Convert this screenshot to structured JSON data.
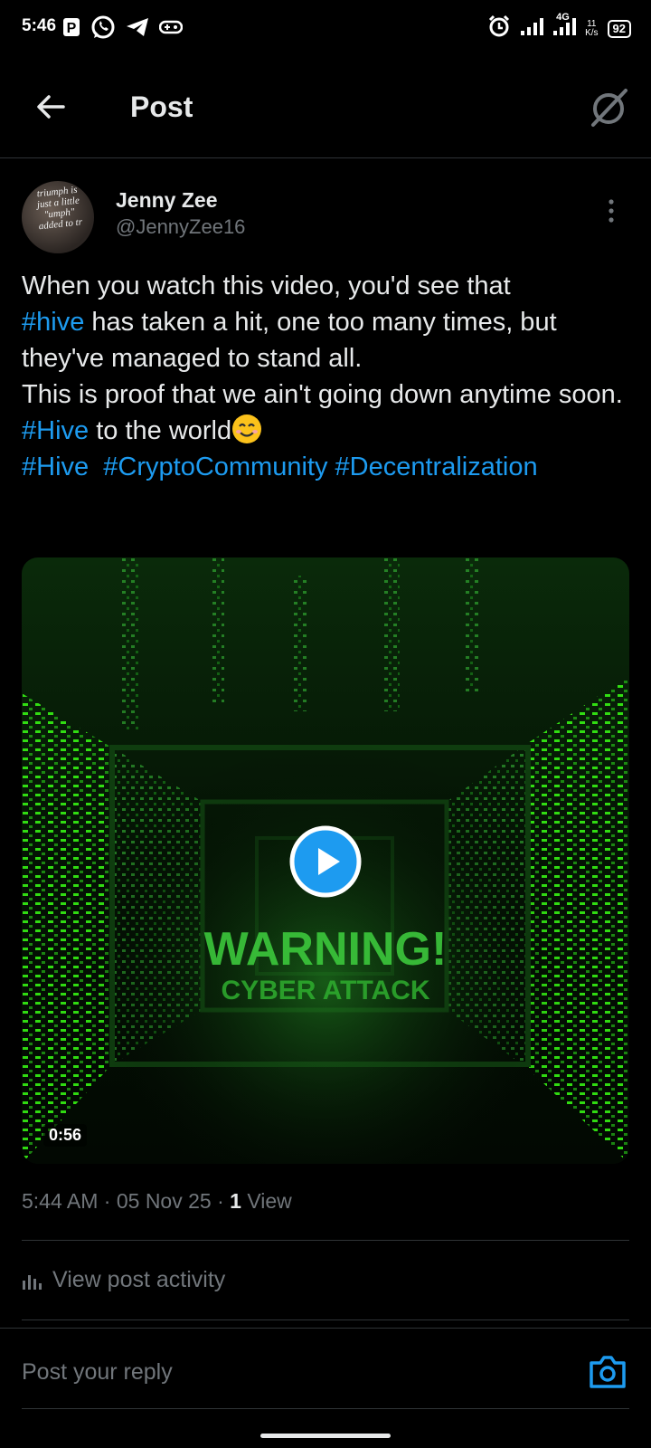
{
  "status_bar": {
    "time": "5:46",
    "net_speed_value": "11",
    "net_speed_unit": "K/s",
    "network_type": "4G",
    "battery": "92",
    "left_icons": [
      "parking-icon",
      "whatsapp-icon",
      "telegram-icon",
      "gamepad-icon"
    ],
    "right_icons": [
      "alarm-icon",
      "signal-icon",
      "signal-4g-icon",
      "battery-icon"
    ]
  },
  "header": {
    "title": "Post",
    "back_icon": "arrow-left-icon",
    "grok_icon": "grok-icon"
  },
  "post": {
    "author_name": "Jenny Zee",
    "author_handle": "@JennyZee16",
    "avatar_lines": [
      "triumph is",
      "just a little",
      "\"umph\"",
      "added to tr"
    ],
    "text": {
      "line1": "When you watch this video, you'd see that",
      "tag_hive1": "#hive",
      "line2_rest": " has taken a hit, one too many times, but they've managed to stand all.",
      "line3": "This is proof that we ain't going down anytime soon.",
      "tag_hive2": "#Hive",
      "line4_rest": " to the world",
      "tag_hive3": "#Hive",
      "tag_crypto": "#CryptoCommunity",
      "tag_decentral": "#Decentralization"
    },
    "video": {
      "overlay_line1": "WARNING!",
      "overlay_line2": "CYBER ATTACK",
      "duration": "0:56"
    },
    "meta": {
      "time": "5:44 AM",
      "date": "05 Nov 25",
      "views_count": "1",
      "views_label": "View",
      "separator": "·"
    },
    "activity_label": "View post activity"
  },
  "reply": {
    "placeholder": "Post your reply"
  },
  "colors": {
    "accent": "#1d9bf0",
    "muted": "#71767b",
    "divider": "#2f3336",
    "matrix_green": "#39ff14"
  }
}
